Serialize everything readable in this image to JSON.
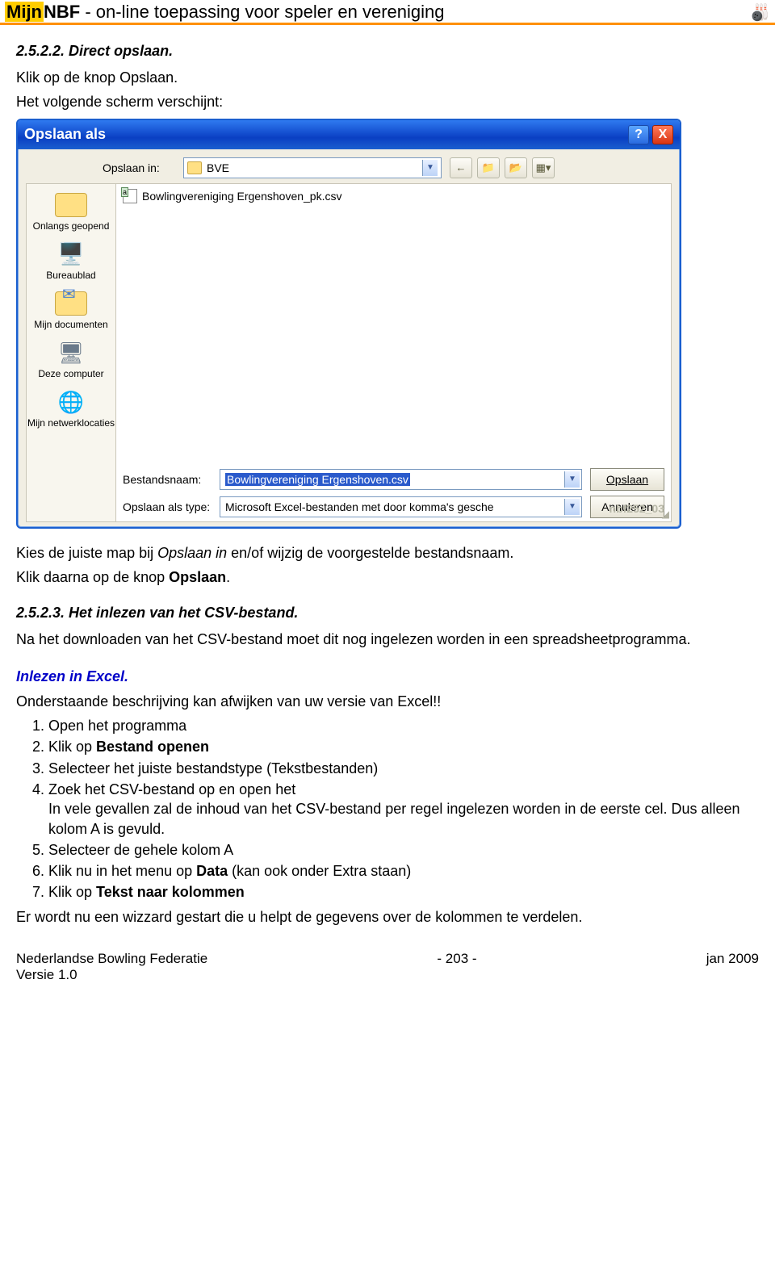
{
  "header": {
    "brand_prefix": "Mijn",
    "brand_suffix": "NBF",
    "subtitle": " - on-line toepassing voor speler en vereniging",
    "icon": "🎳"
  },
  "section1": {
    "num_title": "2.5.2.2. Direct opslaan.",
    "line1": "Klik op de knop Opslaan.",
    "line2": "Het volgende scherm verschijnt:"
  },
  "dialog": {
    "title": "Opslaan als",
    "help": "?",
    "close": "X",
    "saveInLabel": "Opslaan in:",
    "saveInValue": "BVE",
    "places": {
      "recent": "Onlangs geopend",
      "desktop": "Bureaublad",
      "mydocs": "Mijn documenten",
      "mycomp": "Deze computer",
      "network": "Mijn netwerklocaties"
    },
    "fileEntry": "Bowlingvereniging Ergenshoven_pk.csv",
    "filenameLabel": "Bestandsnaam:",
    "filenameValue": "Bowlingvereniging Ergenshoven.csv",
    "typeLabel": "Opslaan als type:",
    "typeValue": "Microsoft Excel-bestanden met door komma's gesche",
    "saveBtn": "Opslaan",
    "cancelBtn": "Annuleren",
    "watermark": "nbf252_03"
  },
  "afterDialog": {
    "l1a": "Kies de juiste map bij ",
    "l1b": "Opslaan in",
    "l1c": " en/of wijzig de voorgestelde bestandsnaam.",
    "l2a": "Klik daarna op de knop ",
    "l2b": "Opslaan",
    "l2c": "."
  },
  "section2": {
    "num_title": "2.5.2.3. Het inlezen van het CSV-bestand.",
    "p1": "Na het downloaden van het CSV-bestand moet dit nog ingelezen worden in een spreadsheetprogramma.",
    "sub": "Inlezen in Excel.",
    "p2": "Onderstaande beschrijving kan afwijken van uw versie van Excel!!",
    "li1": "Open het programma",
    "li2a": "Klik op ",
    "li2b": "Bestand openen",
    "li3": "Selecteer het juiste bestandstype (Tekstbestanden)",
    "li4a": "Zoek het CSV-bestand op en open het",
    "li4b": "In vele gevallen zal de inhoud van het CSV-bestand per regel ingelezen worden in de eerste cel. Dus alleen kolom A is gevuld.",
    "li5": "Selecteer de gehele kolom A",
    "li6a": "Klik nu in het menu op ",
    "li6b": "Data",
    "li6c": " (kan ook onder Extra staan)",
    "li7a": "Klik op ",
    "li7b": "Tekst naar kolommen",
    "p3": "Er wordt nu een wizzard gestart die u helpt de gegevens over de kolommen te verdelen."
  },
  "footer": {
    "left1": "Nederlandse Bowling Federatie",
    "left2": "Versie 1.0",
    "center": "- 203 -",
    "right": "jan 2009"
  }
}
